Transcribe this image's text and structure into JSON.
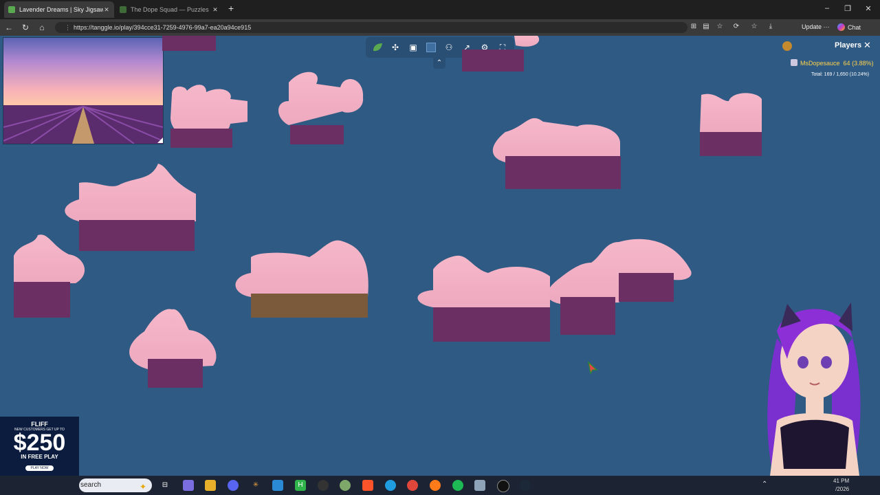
{
  "browser": {
    "tabs": [
      {
        "title": "Lavender Dreams | Sky Jigsaw",
        "active": true
      },
      {
        "title": "The Dope Squad — Puzzles",
        "active": false
      }
    ],
    "url": "https://tanggle.io/play/394cce31-7259-4976-99a7-ea20a94ce915",
    "update_label": "Update",
    "more_label": "···",
    "chat_label": "Chat"
  },
  "game": {
    "players_title": "Players",
    "player": {
      "name": "MsDopesauce",
      "pieces": "64",
      "percent": "(3.88%)"
    },
    "total_text": "Total: 169 / 1,650 (10.24%)",
    "toolbar_icons": [
      "leaf-icon",
      "puzzle-piece-icon",
      "image-icon",
      "background-color-icon",
      "players-icon",
      "share-icon",
      "settings-icon",
      "fullscreen-icon"
    ],
    "colors": {
      "board": "#2f5a83",
      "sky_pink": "#f2b2c6",
      "lavender": "#6b2f63"
    }
  },
  "ad": {
    "brand": "FLIFF",
    "line1": "NEW CUSTOMERS GET UP TO",
    "amount": "$250",
    "line2": "IN FREE PLAY",
    "button": "PLAY NOW"
  },
  "taskbar": {
    "search_label": "search",
    "time": "41 PM",
    "date": "/2026"
  }
}
